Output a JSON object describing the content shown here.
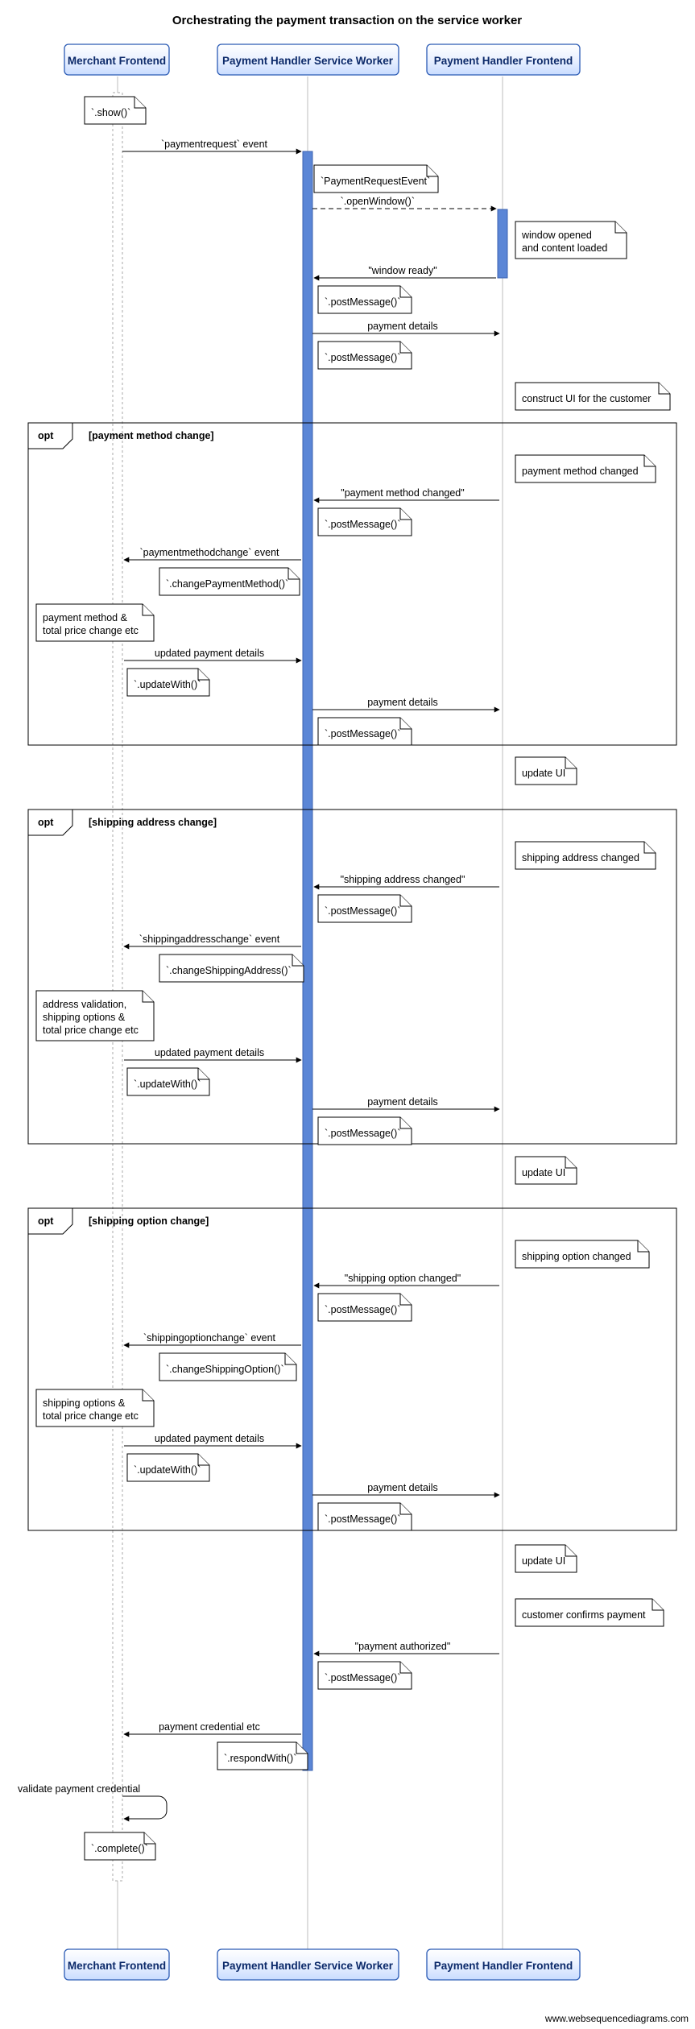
{
  "title": "Orchestrating the payment transaction on the service worker",
  "participants": {
    "merchant": "Merchant Frontend",
    "sw": "Payment Handler Service Worker",
    "frontend": "Payment Handler Frontend"
  },
  "notes": {
    "n_show": "`.show()`",
    "n_PRE": "`PaymentRequestEvent`",
    "n_openWindow": "`.openWindow()`",
    "n_winLoaded1": "window opened",
    "n_winLoaded2": "and content loaded",
    "n_post1": "`.postMessage()`",
    "n_post2": "`.postMessage()`",
    "n_constructUI": "construct UI for the customer",
    "n_pmChangedR": "payment method changed",
    "n_post3": "`.postMessage()`",
    "n_changePM": "`.changePaymentMethod()`",
    "n_pmTotal1": "payment method &",
    "n_pmTotal2": "total price change etc",
    "n_updateWith1": "`.updateWith()`",
    "n_post4": "`.postMessage()`",
    "n_updateUI1": "update UI",
    "n_saChangedR": "shipping address changed",
    "n_post5": "`.postMessage()`",
    "n_changeSA": "`.changeShippingAddress()`",
    "n_addrVal1": "address validation,",
    "n_addrVal2": "shipping options &",
    "n_addrVal3": "total price change etc",
    "n_updateWith2": "`.updateWith()`",
    "n_post6": "`.postMessage()`",
    "n_updateUI2": "update UI",
    "n_soChangedR": "shipping option changed",
    "n_post7": "`.postMessage()`",
    "n_changeSO": "`.changeShippingOption()`",
    "n_soTotal1": "shipping options &",
    "n_soTotal2": "total price change etc",
    "n_updateWith3": "`.updateWith()`",
    "n_post8": "`.postMessage()`",
    "n_updateUI3": "update UI",
    "n_customerConfirms": "customer confirms payment",
    "n_post9": "`.postMessage()`",
    "n_respondWith": "`.respondWith()`",
    "n_validate": "validate payment credential",
    "n_complete": "`.complete()`"
  },
  "messages": {
    "m_paymentrequest": "`paymentrequest` event",
    "m_windowReady": "\"window ready\"",
    "m_paymentDetails1": "payment details",
    "m_pmChanged": "\"payment method changed\"",
    "m_pmchange": "`paymentmethodchange` event",
    "m_updated1": "updated payment details",
    "m_paymentDetails2": "payment details",
    "m_saChanged": "\"shipping address changed\"",
    "m_sachange": "`shippingaddresschange` event",
    "m_updated2": "updated payment details",
    "m_paymentDetails3": "payment details",
    "m_soChanged": "\"shipping option changed\"",
    "m_sochange": "`shippingoptionchange` event",
    "m_updated3": "updated payment details",
    "m_paymentDetails4": "payment details",
    "m_paymentAuth": "\"payment authorized\"",
    "m_payCred": "payment credential etc"
  },
  "opt": {
    "label": "opt",
    "pm": "[payment method change]",
    "sa": "[shipping address change]",
    "so": "[shipping option change]"
  },
  "watermark": "www.websequencediagrams.com",
  "chart_data": {
    "type": "sequence-diagram",
    "title": "Orchestrating the payment transaction on the service worker",
    "participants": [
      "Merchant Frontend",
      "Payment Handler Service Worker",
      "Payment Handler Frontend"
    ],
    "interactions": [
      {
        "type": "note",
        "over": "Merchant Frontend",
        "text": "`.show()`"
      },
      {
        "type": "msg",
        "from": "Merchant Frontend",
        "to": "Payment Handler Service Worker",
        "label": "`paymentrequest` event"
      },
      {
        "type": "note",
        "over": "Payment Handler Service Worker",
        "text": "`PaymentRequestEvent`"
      },
      {
        "type": "msg",
        "from": "Payment Handler Service Worker",
        "to": "Payment Handler Frontend",
        "label": "`.openWindow()`",
        "dashed": true
      },
      {
        "type": "note",
        "right_of": "Payment Handler Frontend",
        "text": "window opened and content loaded"
      },
      {
        "type": "msg",
        "from": "Payment Handler Frontend",
        "to": "Payment Handler Service Worker",
        "label": "\"window ready\""
      },
      {
        "type": "note",
        "over": "Payment Handler Service Worker",
        "text": "`.postMessage()`"
      },
      {
        "type": "msg",
        "from": "Payment Handler Service Worker",
        "to": "Payment Handler Frontend",
        "label": "payment details"
      },
      {
        "type": "note",
        "over": "Payment Handler Service Worker",
        "text": "`.postMessage()`"
      },
      {
        "type": "note",
        "right_of": "Payment Handler Frontend",
        "text": "construct UI for the customer"
      },
      {
        "type": "opt",
        "guard": "[payment method change]",
        "steps": [
          {
            "type": "note",
            "right_of": "Payment Handler Frontend",
            "text": "payment method changed"
          },
          {
            "type": "msg",
            "from": "Payment Handler Frontend",
            "to": "Payment Handler Service Worker",
            "label": "\"payment method changed\""
          },
          {
            "type": "note",
            "over": "Payment Handler Service Worker",
            "text": "`.postMessage()`"
          },
          {
            "type": "msg",
            "from": "Payment Handler Service Worker",
            "to": "Merchant Frontend",
            "label": "`paymentmethodchange` event"
          },
          {
            "type": "note",
            "over": "Payment Handler Service Worker",
            "text": "`.changePaymentMethod()`"
          },
          {
            "type": "note",
            "over": "Merchant Frontend",
            "text": "payment method & total price change etc"
          },
          {
            "type": "msg",
            "from": "Merchant Frontend",
            "to": "Payment Handler Service Worker",
            "label": "updated payment details"
          },
          {
            "type": "note",
            "over": "Merchant Frontend",
            "text": "`.updateWith()`"
          },
          {
            "type": "msg",
            "from": "Payment Handler Service Worker",
            "to": "Payment Handler Frontend",
            "label": "payment details"
          },
          {
            "type": "note",
            "over": "Payment Handler Service Worker",
            "text": "`.postMessage()`"
          },
          {
            "type": "note",
            "right_of": "Payment Handler Frontend",
            "text": "update UI"
          }
        ]
      },
      {
        "type": "opt",
        "guard": "[shipping address change]",
        "steps": [
          {
            "type": "note",
            "right_of": "Payment Handler Frontend",
            "text": "shipping address changed"
          },
          {
            "type": "msg",
            "from": "Payment Handler Frontend",
            "to": "Payment Handler Service Worker",
            "label": "\"shipping address changed\""
          },
          {
            "type": "note",
            "over": "Payment Handler Service Worker",
            "text": "`.postMessage()`"
          },
          {
            "type": "msg",
            "from": "Payment Handler Service Worker",
            "to": "Merchant Frontend",
            "label": "`shippingaddresschange` event"
          },
          {
            "type": "note",
            "over": "Payment Handler Service Worker",
            "text": "`.changeShippingAddress()`"
          },
          {
            "type": "note",
            "over": "Merchant Frontend",
            "text": "address validation, shipping options & total price change etc"
          },
          {
            "type": "msg",
            "from": "Merchant Frontend",
            "to": "Payment Handler Service Worker",
            "label": "updated payment details"
          },
          {
            "type": "note",
            "over": "Merchant Frontend",
            "text": "`.updateWith()`"
          },
          {
            "type": "msg",
            "from": "Payment Handler Service Worker",
            "to": "Payment Handler Frontend",
            "label": "payment details"
          },
          {
            "type": "note",
            "over": "Payment Handler Service Worker",
            "text": "`.postMessage()`"
          },
          {
            "type": "note",
            "right_of": "Payment Handler Frontend",
            "text": "update UI"
          }
        ]
      },
      {
        "type": "opt",
        "guard": "[shipping option change]",
        "steps": [
          {
            "type": "note",
            "right_of": "Payment Handler Frontend",
            "text": "shipping option changed"
          },
          {
            "type": "msg",
            "from": "Payment Handler Frontend",
            "to": "Payment Handler Service Worker",
            "label": "\"shipping option changed\""
          },
          {
            "type": "note",
            "over": "Payment Handler Service Worker",
            "text": "`.postMessage()`"
          },
          {
            "type": "msg",
            "from": "Payment Handler Service Worker",
            "to": "Merchant Frontend",
            "label": "`shippingoptionchange` event"
          },
          {
            "type": "note",
            "over": "Payment Handler Service Worker",
            "text": "`.changeShippingOption()`"
          },
          {
            "type": "note",
            "over": "Merchant Frontend",
            "text": "shipping options & total price change etc"
          },
          {
            "type": "msg",
            "from": "Merchant Frontend",
            "to": "Payment Handler Service Worker",
            "label": "updated payment details"
          },
          {
            "type": "note",
            "over": "Merchant Frontend",
            "text": "`.updateWith()`"
          },
          {
            "type": "msg",
            "from": "Payment Handler Service Worker",
            "to": "Payment Handler Frontend",
            "label": "payment details"
          },
          {
            "type": "note",
            "over": "Payment Handler Service Worker",
            "text": "`.postMessage()`"
          },
          {
            "type": "note",
            "right_of": "Payment Handler Frontend",
            "text": "update UI"
          }
        ]
      },
      {
        "type": "note",
        "right_of": "Payment Handler Frontend",
        "text": "customer confirms payment"
      },
      {
        "type": "msg",
        "from": "Payment Handler Frontend",
        "to": "Payment Handler Service Worker",
        "label": "\"payment authorized\""
      },
      {
        "type": "note",
        "over": "Payment Handler Service Worker",
        "text": "`.postMessage()`"
      },
      {
        "type": "msg",
        "from": "Payment Handler Service Worker",
        "to": "Merchant Frontend",
        "label": "payment credential etc"
      },
      {
        "type": "note",
        "over": "Payment Handler Service Worker",
        "text": "`.respondWith()`"
      },
      {
        "type": "self",
        "participant": "Merchant Frontend",
        "label": "validate payment credential"
      },
      {
        "type": "note",
        "over": "Merchant Frontend",
        "text": "`.complete()`"
      }
    ]
  }
}
